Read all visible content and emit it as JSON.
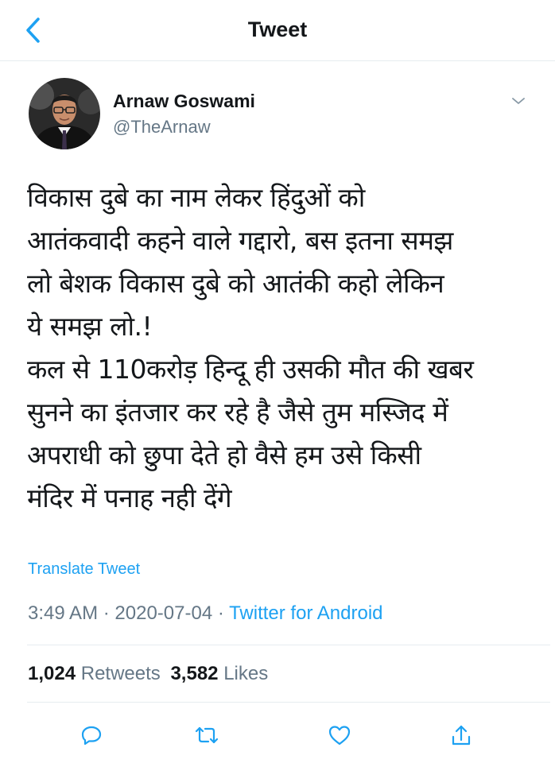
{
  "header": {
    "title": "Tweet",
    "back_icon": "chevron-left-icon"
  },
  "author": {
    "name": "Arnaw Goswami",
    "handle": "@TheArnaw",
    "avatar_icon": "avatar"
  },
  "tweet": {
    "lines": [
      "विकास दुबे का नाम लेकर हिंदुओं को",
      "आतंकवादी कहने वाले गद्दारो, बस इतना समझ",
      "लो बेशक विकास दुबे को आतंकी कहो लेकिन",
      "ये समझ लो.!",
      "कल से 110करोड़ हिन्दू ही उसकी मौत की खबर",
      "सुनने का इंतजार कर रहे है जैसे तुम मस्जिद में",
      "अपराधी को छुपा देते हो वैसे हम उसे किसी",
      "मंदिर में पनाह नही देंगे"
    ],
    "translate_label": "Translate Tweet",
    "time": "3:49 AM",
    "separator": "·",
    "date": "2020-07-04",
    "source": "Twitter for Android"
  },
  "stats": {
    "retweets_count": "1,024",
    "retweets_label": "Retweets",
    "likes_count": "3,582",
    "likes_label": "Likes"
  },
  "actions": {
    "reply_icon": "reply-icon",
    "retweet_icon": "retweet-icon",
    "like_icon": "heart-icon",
    "share_icon": "share-icon"
  },
  "colors": {
    "accent": "#1da1f2",
    "text": "#14171a",
    "secondary": "#657786",
    "divider": "#e6ecf0"
  }
}
